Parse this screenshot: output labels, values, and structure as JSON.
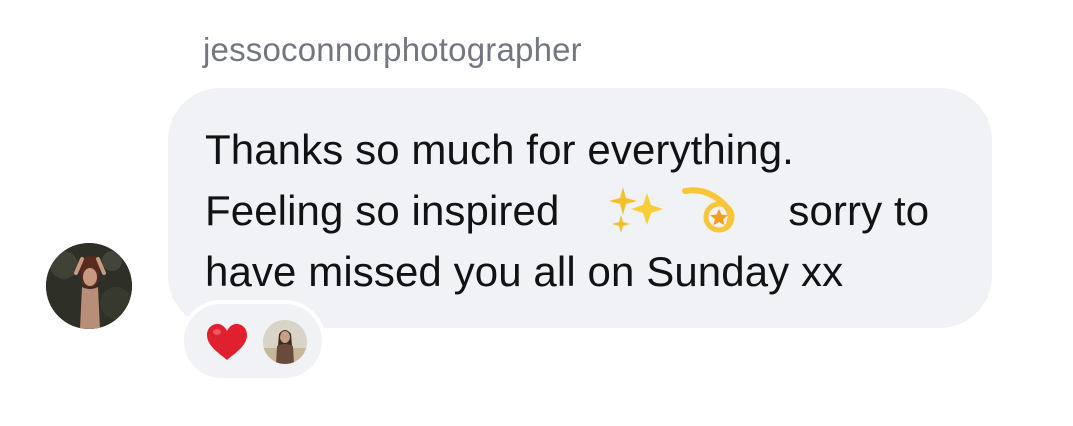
{
  "message": {
    "sender": "jessoconnorphotographer",
    "lines": [
      "Thanks so much for everything.",
      "Feeling so inspired",
      "sorry to",
      "have missed you all on Sunday xx"
    ],
    "emojis": [
      "sparkles-icon",
      "dizzy-icon"
    ]
  },
  "reactions": {
    "emoji": "heart-icon",
    "reactor": "reactor-avatar"
  },
  "colors": {
    "bubble": "#f1f2f5",
    "text": "#111214",
    "sender": "#737780",
    "heart": "#e0202f"
  }
}
